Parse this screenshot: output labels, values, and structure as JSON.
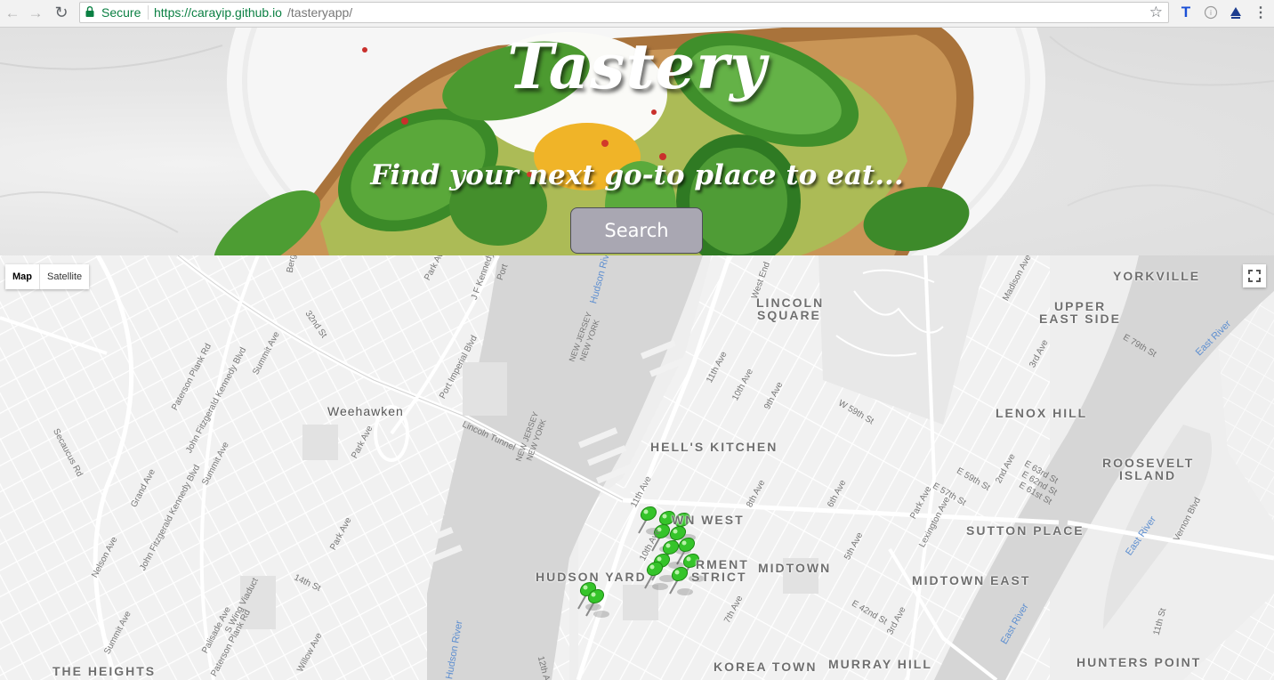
{
  "browser": {
    "secure_label": "Secure",
    "url_host": "https://carayip.github.io",
    "url_path": "/tasteryapp/",
    "icons": [
      "back-arrow-icon",
      "forward-arrow-icon",
      "reload-icon",
      "lock-icon",
      "star-icon",
      "extension-t-icon",
      "extension-circle-icon",
      "extension-triangle-icon",
      "menu-dots-icon"
    ]
  },
  "hero": {
    "title": "Tastery",
    "tagline": "Find your next go-to place to eat...",
    "search_label": "Search"
  },
  "map": {
    "controls": {
      "map_label": "Map",
      "satellite_label": "Satellite",
      "fullscreen_icon": "fullscreen-icon"
    },
    "neighborhoods": {
      "yorkville": "YORKVILLE",
      "upper_east_side_1": "UPPER",
      "upper_east_side_2": "EAST SIDE",
      "lincoln_square_1": "LINCOLN",
      "lincoln_square_2": "SQUARE",
      "lenox_hill": "LENOX HILL",
      "hells_kitchen": "HELL'S KITCHEN",
      "roosevelt_island_1": "ROOSEVELT",
      "roosevelt_island_2": "ISLAND",
      "sutton_place": "SUTTON PLACE",
      "midtown": "MIDTOWN",
      "midtown_east": "MIDTOWN EAST",
      "hudson_yards": "HUDSON YARD",
      "garment": "RMENT",
      "district": "STRICT",
      "town_west": "WN WEST",
      "koreatown": "KOREA TOWN",
      "murray_hill": "MURRAY HILL",
      "hunters_point": "HUNTERS POINT",
      "the_heights": "THE HEIGHTS"
    },
    "towns": {
      "weehawken": "Weehawken"
    },
    "water": {
      "hudson_river_top": "Hudson River",
      "hudson_river_bottom": "Hudson River",
      "east_river_1": "East River",
      "east_river_2": "East River",
      "east_river_3": "East River"
    },
    "borders": {
      "nj_ny_1a": "NEW JERSEY",
      "nj_ny_1b": "NEW YORK",
      "nj_ny_2a": "NEW JERSEY",
      "nj_ny_2b": "NEW YORK"
    },
    "streets": {
      "secaucus_rd": "Secaucus Rd",
      "paterson_plank_rd": "Paterson Plank Rd",
      "jfk_blvd_1": "John Fitzgerald Kennedy Blvd",
      "jfk_blvd_2": "John Fitzgerald Kennedy Blvd",
      "summit_ave_1": "Summit Ave",
      "summit_ave_2": "Summit Ave",
      "summit_ave_3": "Summit Ave",
      "grand_ave": "Grand Ave",
      "nelson_ave": "Nelson Ave",
      "palisade_ave": "Palisade Ave",
      "paterson_plank_rd_2": "Paterson Plank Rd",
      "s_wing_viaduct": "S Wing Viaduct",
      "willow_ave": "Willow Ave",
      "st_14th": "14th St",
      "st_32nd": "32nd St",
      "park_ave_nj_1": "Park Ave",
      "park_ave_nj_2": "Park Ave",
      "park_ave_nj_3": "Park Ave",
      "port_imperial_blvd": "Port Imperial Blvd",
      "jf_kennedy": "J F Kennedy",
      "port": "Port",
      "bergen": "Berg",
      "lincoln_tunnel": "Lincoln Tunnel",
      "ave_11th_a": "11th Ave",
      "ave_11th_b": "11th Ave",
      "ave_10th_a": "10th Ave",
      "ave_10th_b": "10th Ave",
      "ave_9th": "9th Ave",
      "ave_8th": "8th Ave",
      "ave_7th": "7th Ave",
      "ave_6th": "6th Ave",
      "ave_5th": "5th Ave",
      "ave_12th": "12th Ave",
      "park_ave_ny": "Park Ave",
      "lexington_ave": "Lexington Ave",
      "ave_3rd_a": "3rd Ave",
      "ave_3rd_b": "3rd Ave",
      "ave_2nd": "2nd Ave",
      "ave_11th_st": "11th St",
      "vernon_blvd": "Vernon Blvd",
      "w_59th": "W 59th St",
      "e_59th": "E 59th St",
      "e_57th": "E 57th St",
      "e_63rd": "E 63rd St",
      "e_62nd": "E 62nd St",
      "e_61st": "E 61st St",
      "e_79th": "E 79th St",
      "e_42nd": "E 42nd St",
      "madison_ave": "Madison Ave",
      "west_end": "West End"
    },
    "pin_color": "#35c42a"
  }
}
